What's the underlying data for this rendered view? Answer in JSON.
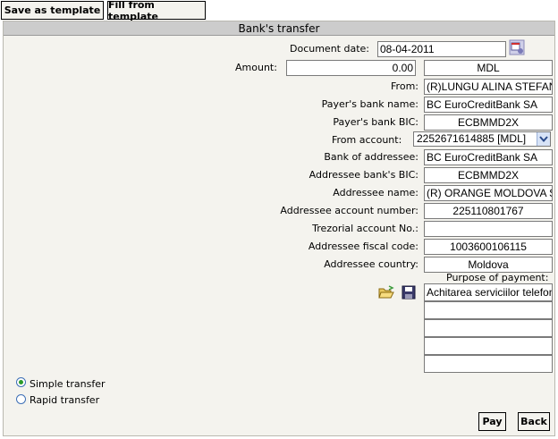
{
  "toolbar": {
    "save_template": "Save as template",
    "fill_template": "Fill from template"
  },
  "form": {
    "title": "Bank's transfer",
    "document_date_label": "Document date:",
    "document_date": "08-04-2011",
    "amount_label": "Amount:",
    "amount": "0.00",
    "currency": "MDL",
    "from_label": "From:",
    "from": "(R)LUNGU ALINA STEFANOVNA",
    "payer_bank_name_label": "Payer's bank name:",
    "payer_bank_name": "BC EuroCreditBank SA",
    "payer_bank_bic_label": "Payer's bank BIC:",
    "payer_bank_bic": "ECBMMD2X",
    "from_account_label": "From account:",
    "from_account": "2252671614885 [MDL]",
    "bank_of_addressee_label": "Bank of addressee:",
    "bank_of_addressee": "BC EuroCreditBank SA",
    "addressee_bank_bic_label": "Addressee bank's BIC:",
    "addressee_bank_bic": "ECBMMD2X",
    "addressee_name_label": "Addressee name:",
    "addressee_name": "(R) ORANGE MOLDOVA SA",
    "addressee_account_number_label": "Addressee account number:",
    "addressee_account_number": "225110801767",
    "trezorial_account_label": "Trezorial account No.:",
    "trezorial_account": "",
    "addressee_fiscal_code_label": "Addressee fiscal code:",
    "addressee_fiscal_code": "1003600106115",
    "addressee_country_label": "Addressee country:",
    "addressee_country": "Moldova",
    "purpose_label": "Purpose of payment:",
    "purpose_lines": [
      "Achitarea serviciilor telefonie mobila",
      "",
      "",
      "",
      ""
    ]
  },
  "transfer_type": {
    "simple": "Simple transfer",
    "rapid": "Rapid transfer",
    "selected": "simple"
  },
  "actions": {
    "pay": "Pay",
    "back": "Back"
  },
  "icons": {
    "calendar": "calendar-icon",
    "open_folder": "open-folder-icon",
    "save": "floppy-save-icon",
    "dropdown": "chevron-down-icon"
  }
}
